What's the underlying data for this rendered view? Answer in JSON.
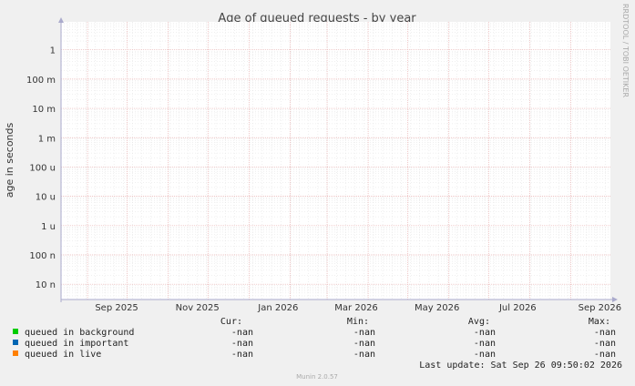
{
  "chart_data": {
    "type": "line",
    "title": "Age of queued requests - by year",
    "ylabel": "age in seconds",
    "yscale": "log",
    "ylim": [
      3e-09,
      9
    ],
    "xlim": [
      "2025-08-12",
      "2026-10-01"
    ],
    "grid": true,
    "y_ticks": [
      {
        "value": 1,
        "label": "1"
      },
      {
        "value": 0.1,
        "label": "100 m"
      },
      {
        "value": 0.01,
        "label": "10 m"
      },
      {
        "value": 0.001,
        "label": "1 m"
      },
      {
        "value": 0.0001,
        "label": "100 u"
      },
      {
        "value": 1e-05,
        "label": "10 u"
      },
      {
        "value": 1e-06,
        "label": "1 u"
      },
      {
        "value": 1e-07,
        "label": "100 n"
      },
      {
        "value": 1e-08,
        "label": "10 n"
      }
    ],
    "x_ticks": [
      {
        "date": "2025-09-01",
        "label": "Sep 2025"
      },
      {
        "date": "2025-11-01",
        "label": "Nov 2025"
      },
      {
        "date": "2026-01-01",
        "label": "Jan 2026"
      },
      {
        "date": "2026-03-01",
        "label": "Mar 2026"
      },
      {
        "date": "2026-05-01",
        "label": "May 2026"
      },
      {
        "date": "2026-07-01",
        "label": "Jul 2026"
      },
      {
        "date": "2026-09-01",
        "label": "Sep 2026"
      }
    ],
    "series": [
      {
        "name": "queued in background",
        "color": "#00cc00",
        "values": [],
        "cur": "-nan",
        "min": "-nan",
        "avg": "-nan",
        "max": "-nan"
      },
      {
        "name": "queued in important",
        "color": "#0066b3",
        "values": [],
        "cur": "-nan",
        "min": "-nan",
        "avg": "-nan",
        "max": "-nan"
      },
      {
        "name": "queued in live",
        "color": "#ff8000",
        "values": [],
        "cur": "-nan",
        "min": "-nan",
        "avg": "-nan",
        "max": "-nan"
      }
    ]
  },
  "legend": {
    "headers": {
      "cur": "Cur:",
      "min": "Min:",
      "avg": "Avg:",
      "max": "Max:"
    }
  },
  "side_label": "RRDTOOL / TOBI OETIKER",
  "last_update": "Last update: Sat Sep 26 09:50:02 2026",
  "footer": "Munin 2.0.57"
}
